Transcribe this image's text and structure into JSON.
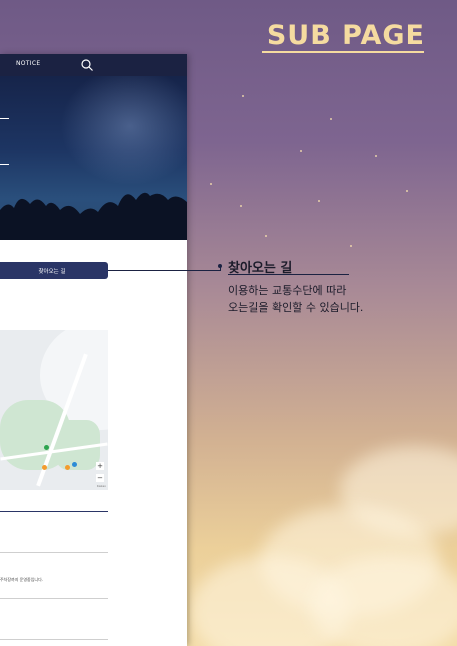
{
  "title": "SUB PAGE",
  "mock": {
    "nav_notice": "NOTICE",
    "directions_button": "찾아오는 길",
    "notice_text": "주차장까지 운영중입니다.",
    "map_credit": "Kakao"
  },
  "callout": {
    "heading": "찾아오는 길",
    "body_line1": "이용하는 교통수단에 따라",
    "body_line2": "오는길을 확인할 수 있습니다."
  },
  "colors": {
    "accent": "#f5dba0",
    "navy": "#1b2242",
    "button": "#2a3566"
  }
}
